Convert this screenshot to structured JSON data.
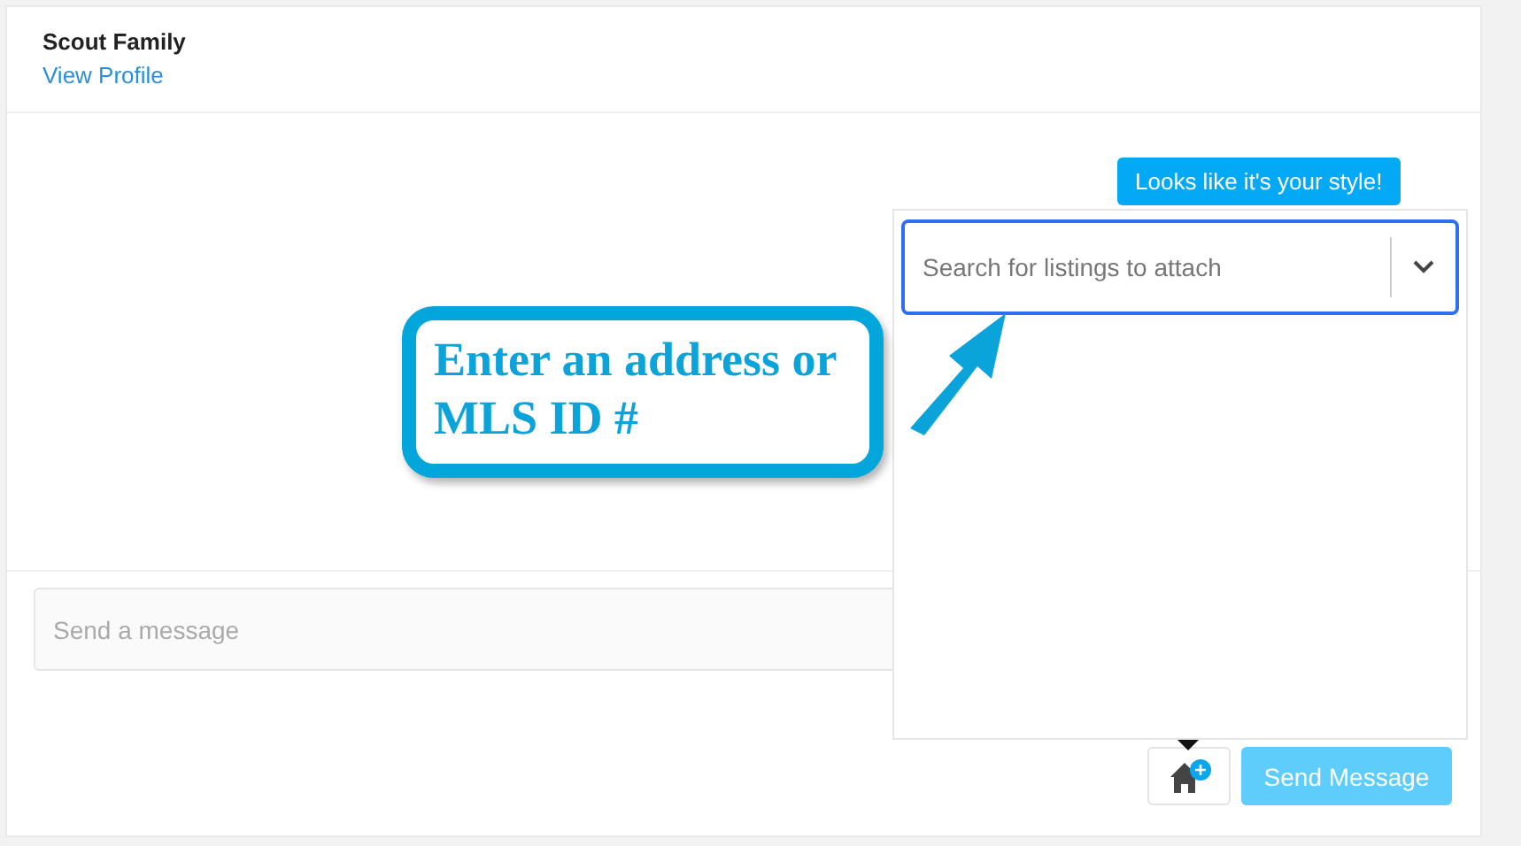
{
  "header": {
    "title": "Scout Family",
    "link": "View Profile"
  },
  "composer": {
    "placeholder": "Send a message"
  },
  "tooltip": "Looks like it's your style!",
  "listing_search": {
    "placeholder": "Search for listings to attach"
  },
  "callout": "Enter an address or MLS ID #",
  "send_button": {
    "label": "Send Message",
    "disabled": true
  }
}
